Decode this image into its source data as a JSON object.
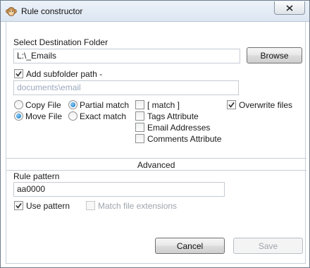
{
  "window": {
    "title": "Rule constructor"
  },
  "destination": {
    "label": "Select Destination Folder",
    "path": "L:\\_Emails",
    "browse_label": "Browse"
  },
  "subfolder": {
    "checkbox_label": "Add subfolder path -",
    "checked": true,
    "placeholder": "documents\\email"
  },
  "action": {
    "copy_label": "Copy File",
    "move_label": "Move File",
    "selected": "Move File"
  },
  "match_mode": {
    "partial_label": "Partial match",
    "exact_label": "Exact match",
    "selected": "Partial match"
  },
  "match_targets": {
    "match_label": "[ match ]",
    "tags_label": "Tags Attribute",
    "email_label": "Email Addresses",
    "comments_label": "Comments Attribute"
  },
  "overwrite": {
    "label": "Overwrite files",
    "checked": true
  },
  "advanced": {
    "header": "Advanced",
    "rule_pattern_label": "Rule pattern",
    "rule_pattern_value": "aa0000",
    "use_pattern_label": "Use pattern",
    "use_pattern_checked": true,
    "match_ext_label": "Match file extensions",
    "match_ext_enabled": false
  },
  "footer": {
    "cancel_label": "Cancel",
    "save_label": "Save"
  },
  "colors": {
    "accent": "#2a8bd3",
    "placeholder": "#9aa9bd",
    "disabled": "#9ea5ad"
  }
}
